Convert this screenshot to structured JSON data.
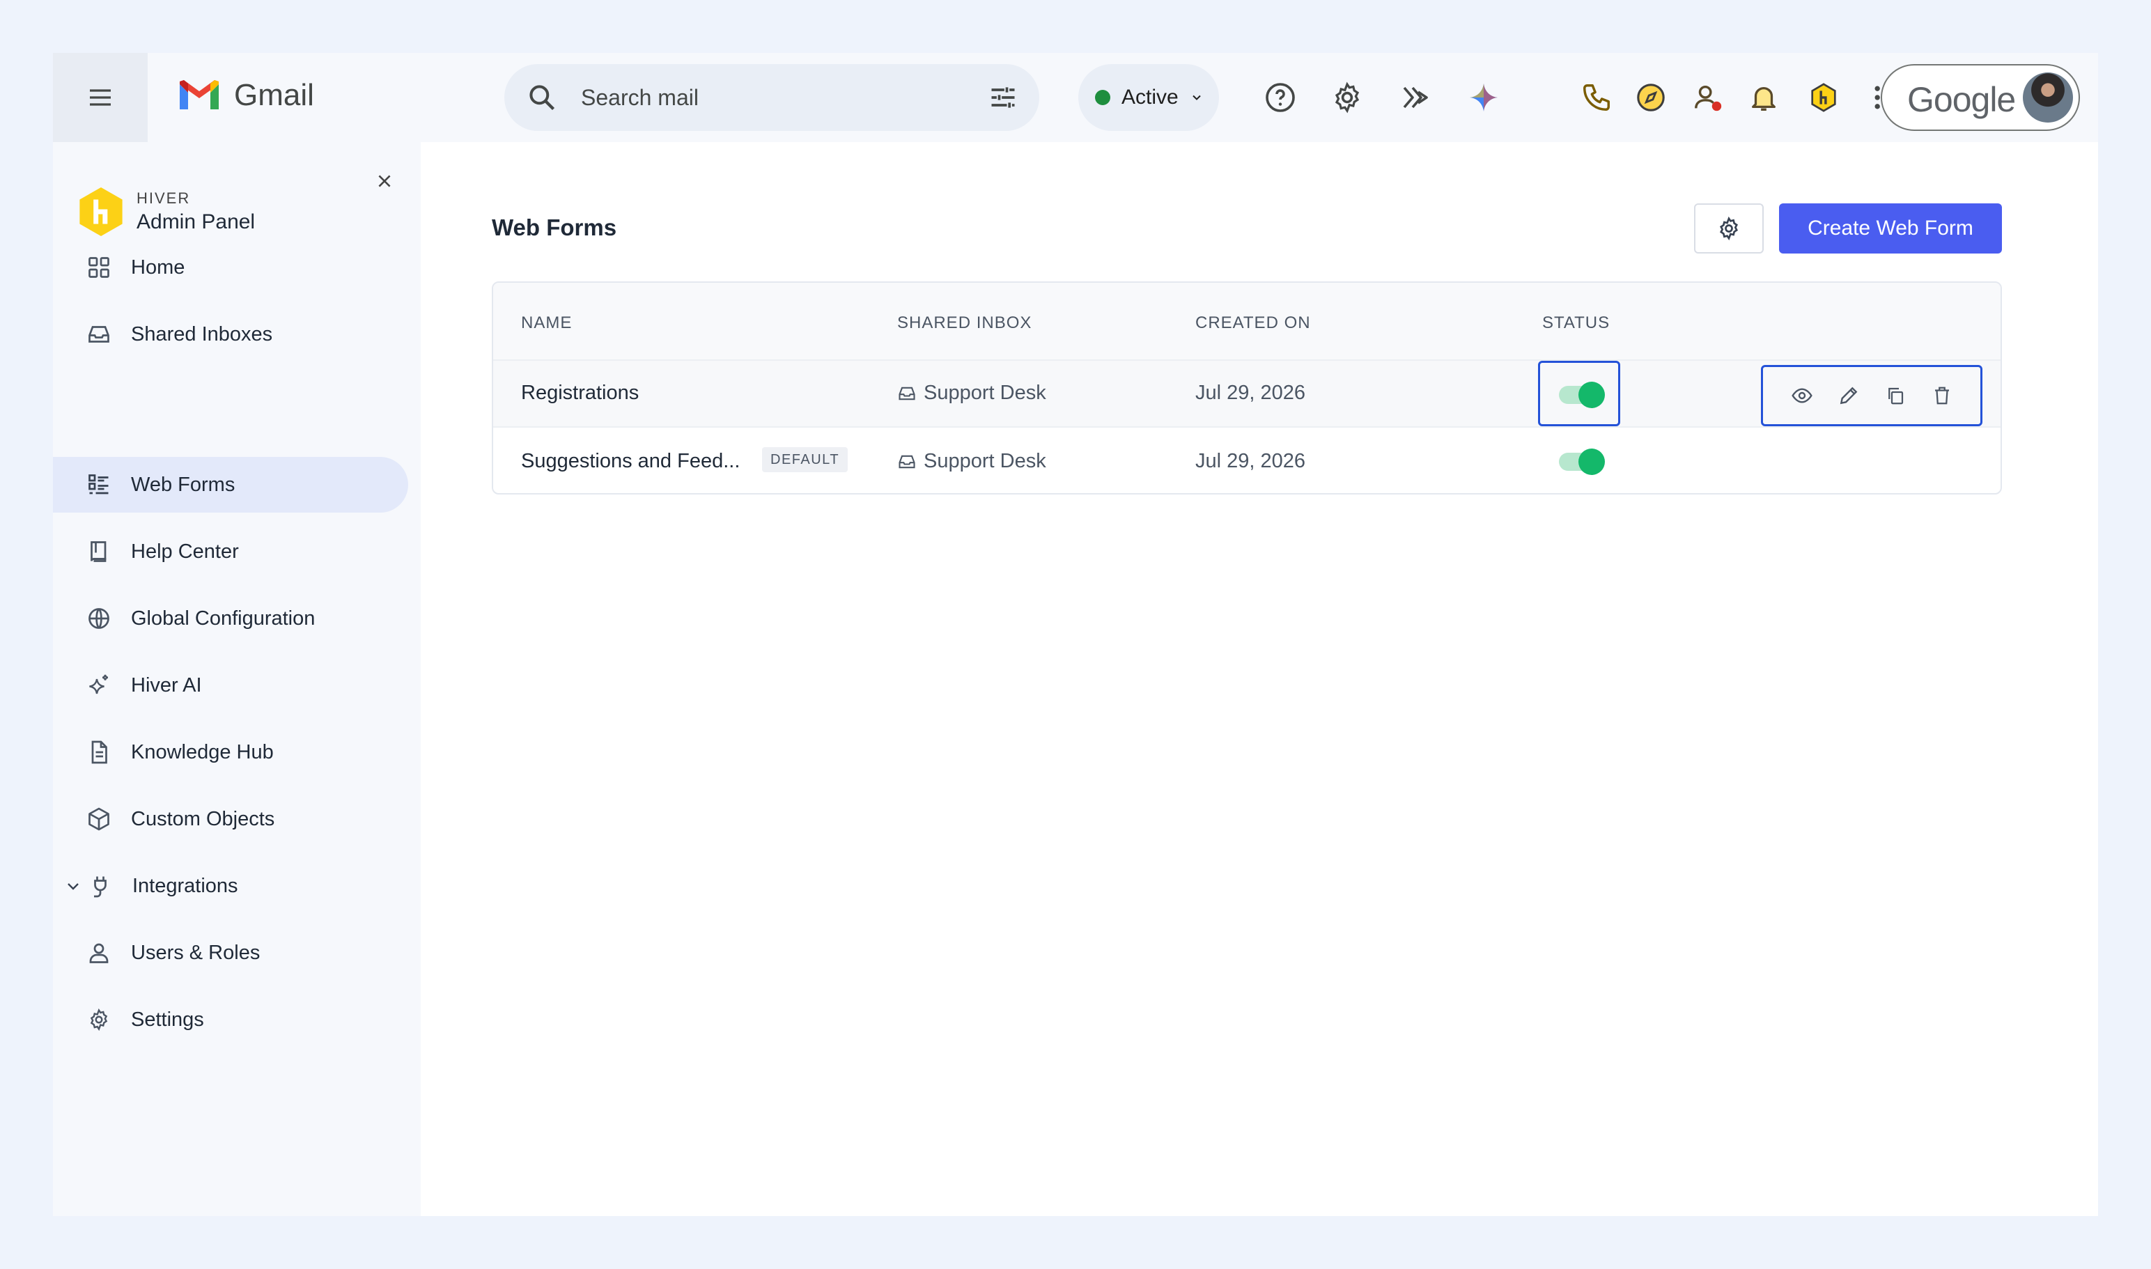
{
  "gmail": {
    "logo_text": "Gmail",
    "search_placeholder": "Search mail",
    "status_label": "Active",
    "account_brand": "Google",
    "colors": {
      "status_green": "#1e8e3e"
    }
  },
  "sidebar": {
    "brand": "HIVER",
    "title": "Admin Panel",
    "items": [
      {
        "label": "Home",
        "icon": "grid-icon"
      },
      {
        "label": "Shared Inboxes",
        "icon": "inbox-icon"
      },
      {
        "label": "Web Forms",
        "icon": "form-list-icon",
        "active": true
      },
      {
        "label": "Help Center",
        "icon": "book-icon"
      },
      {
        "label": "Global Configuration",
        "icon": "globe-icon"
      },
      {
        "label": "Hiver AI",
        "icon": "sparkle-icon"
      },
      {
        "label": "Knowledge Hub",
        "icon": "document-icon"
      },
      {
        "label": "Custom Objects",
        "icon": "cube-icon"
      },
      {
        "label": "Integrations",
        "icon": "plug-icon",
        "expandable": true
      },
      {
        "label": "Users & Roles",
        "icon": "user-icon"
      },
      {
        "label": "Settings",
        "icon": "gear-icon"
      }
    ]
  },
  "main": {
    "title": "Web Forms",
    "create_button": "Create Web Form",
    "colors": {
      "primary": "#4a5df0",
      "toggle_on": "#14b86a",
      "focus": "#2452d8"
    },
    "table": {
      "columns": [
        "NAME",
        "SHARED INBOX",
        "CREATED ON",
        "STATUS"
      ],
      "rows": [
        {
          "name": "Registrations",
          "inbox": "Support Desk",
          "created": "Jul 29, 2026",
          "status_on": true
        },
        {
          "name": "Suggestions and Feed...",
          "badge": "DEFAULT",
          "inbox": "Support Desk",
          "created": "Jul 29, 2026",
          "status_on": true
        }
      ]
    }
  }
}
